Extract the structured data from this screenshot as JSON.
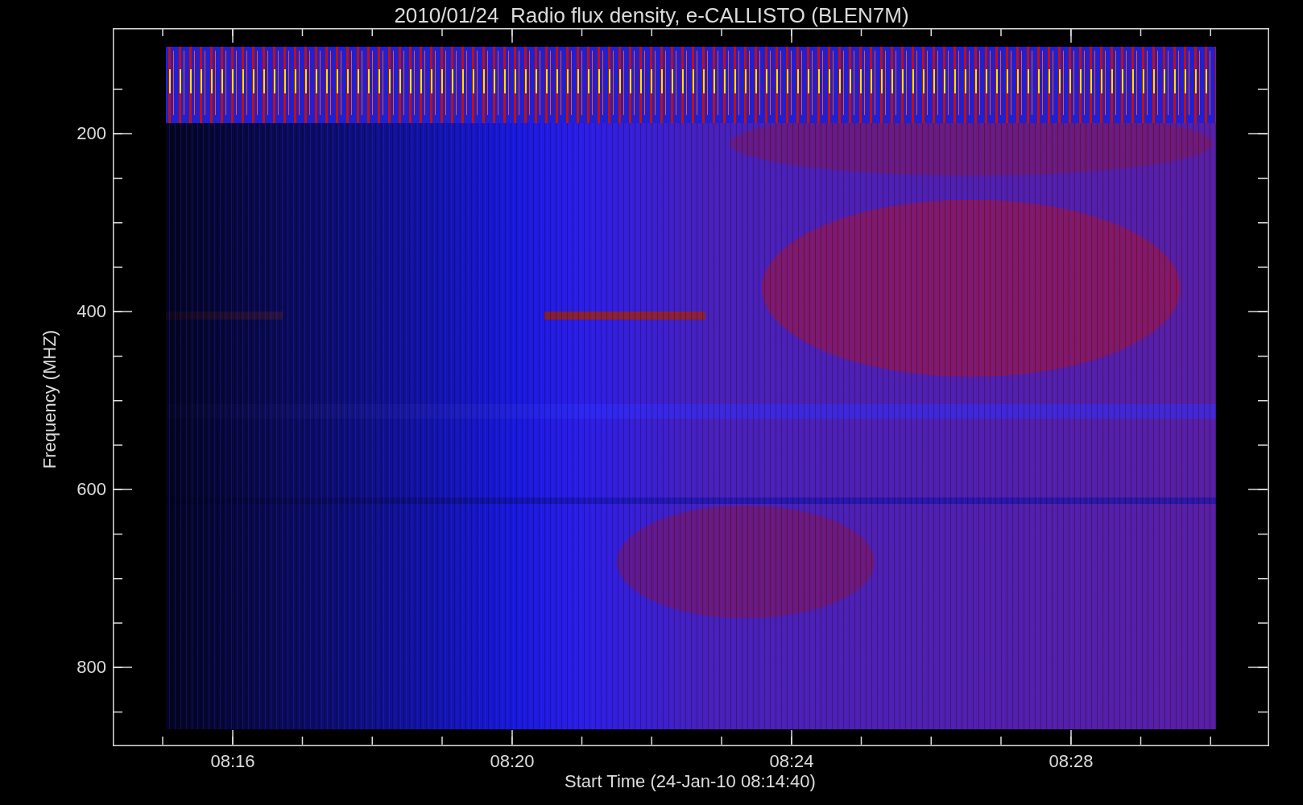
{
  "title": "2010/01/24  Radio flux density, e-CALLISTO (BLEN7M)",
  "y_axis": {
    "label": "Frequency (MHZ)",
    "ticks": [
      "200",
      "400",
      "600",
      "800"
    ]
  },
  "x_axis": {
    "label": "Start Time (24-Jan-10 08:14:40)",
    "ticks": [
      "08:16",
      "08:20",
      "08:24",
      "08:28"
    ]
  }
}
